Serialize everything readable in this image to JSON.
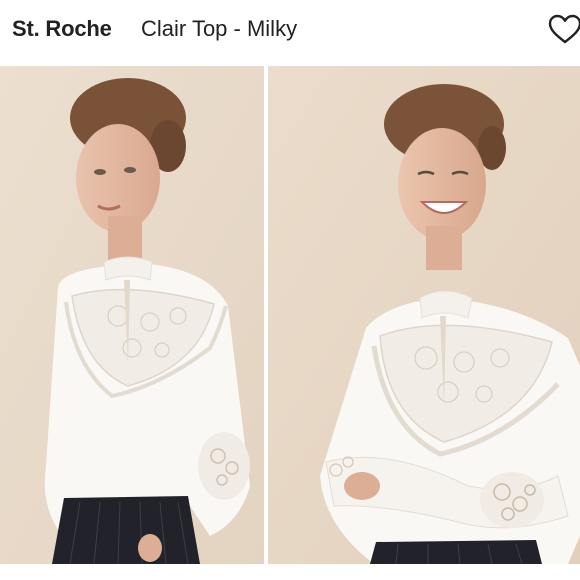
{
  "listing": {
    "brand": "St. Roche",
    "title": "Clair Top - Milky"
  },
  "icons": {
    "like": "heart-outline-icon"
  },
  "colors": {
    "background": "#ffffff",
    "photo_backdrop": "#e9dccd",
    "text": "#222222"
  }
}
